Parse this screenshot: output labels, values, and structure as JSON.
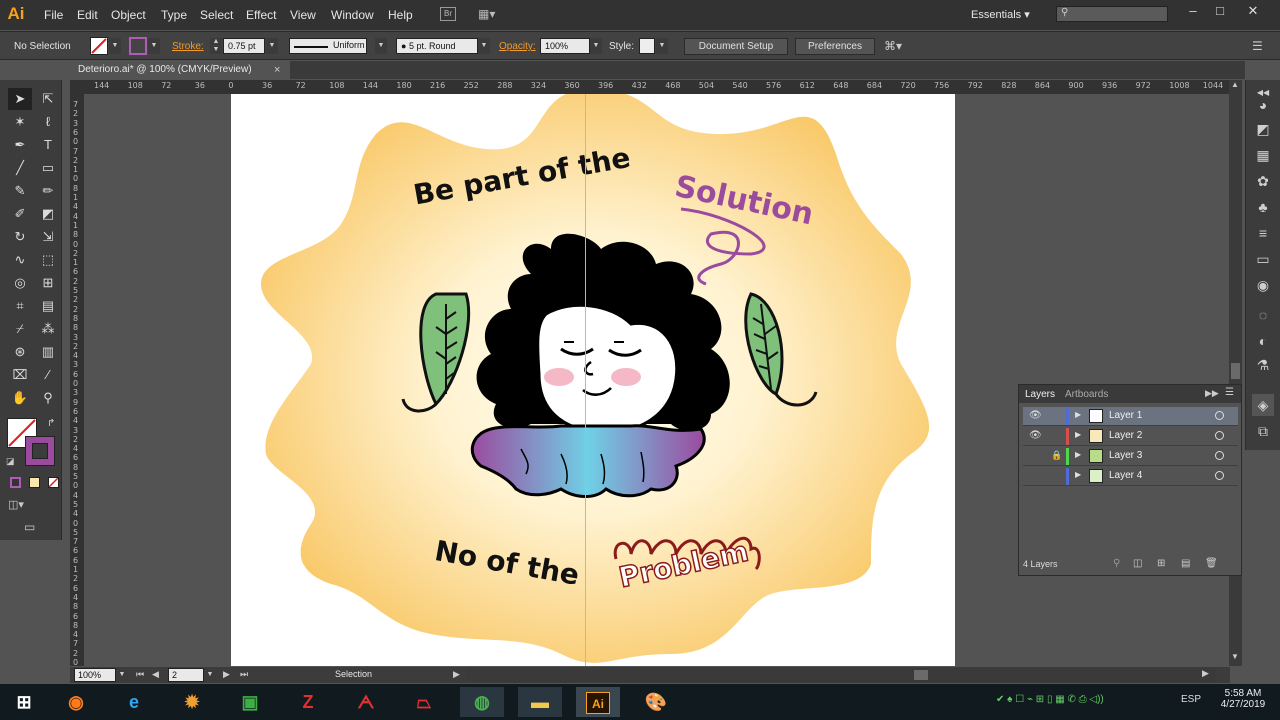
{
  "app": {
    "logo": "Ai",
    "menus": [
      "File",
      "Edit",
      "Object",
      "Type",
      "Select",
      "Effect",
      "View",
      "Window",
      "Help"
    ],
    "workspace": "Essentials",
    "window_buttons": [
      "–",
      "□",
      "✕"
    ]
  },
  "control": {
    "selection": "No Selection",
    "stroke_label": "Stroke:",
    "stroke_weight": "0.75 pt",
    "profile": "Uniform",
    "brush": "5 pt. Round",
    "opacity_label": "Opacity:",
    "opacity": "100%",
    "style_label": "Style:",
    "document_setup": "Document Setup",
    "preferences": "Preferences"
  },
  "document": {
    "tab_title": "Deterioro.ai* @ 100% (CMYK/Preview)",
    "close": "×"
  },
  "ruler": {
    "top": [
      "144",
      "108",
      "72",
      "36",
      "0",
      "36",
      "72",
      "108",
      "144",
      "180",
      "216",
      "252",
      "288",
      "324",
      "360",
      "396",
      "432",
      "468",
      "504",
      "540",
      "576",
      "612",
      "648",
      "684",
      "720",
      "756",
      "792",
      "828",
      "864",
      "900",
      "936",
      "972",
      "1008",
      "1044"
    ],
    "left": [
      "7",
      "2",
      "3",
      "6",
      "0",
      "7",
      "2",
      "1",
      "0",
      "8",
      "1",
      "4",
      "4",
      "1",
      "8",
      "0",
      "2",
      "1",
      "6",
      "2",
      "5",
      "2",
      "2",
      "8",
      "8",
      "3",
      "2",
      "4",
      "3",
      "6",
      "0",
      "3",
      "9",
      "6",
      "4",
      "3",
      "2",
      "4",
      "6",
      "8",
      "5",
      "0",
      "4",
      "5",
      "4",
      "0",
      "5",
      "7",
      "6",
      "6",
      "1",
      "2",
      "6",
      "4",
      "8",
      "6",
      "8",
      "4",
      "7",
      "2",
      "0"
    ]
  },
  "artwork": {
    "line1": "Be part of the",
    "highlight1": "Solution",
    "line2": "No of the",
    "highlight2": "Problem",
    "colors": {
      "blob_outer": "#f9c96a",
      "blob_inner": "#fffdf2",
      "solution": "#9b4b9e",
      "problem": "#8b1a1a",
      "leaf": "#7fc07a",
      "skirt_purple": "#9b4b9e",
      "skirt_blue": "#6fd0e6"
    }
  },
  "status": {
    "zoom": "100%",
    "artboard_number": "2",
    "tool": "Selection"
  },
  "layers": {
    "tabs": [
      "Layers",
      "Artboards"
    ],
    "rows": [
      {
        "name": "Layer 1",
        "color": "#4f6bd6",
        "visible": true,
        "locked": false,
        "thumb": "#ffffff"
      },
      {
        "name": "Layer 2",
        "color": "#d64f4f",
        "visible": true,
        "locked": false,
        "thumb": "#f9e9b8"
      },
      {
        "name": "Layer 3",
        "color": "#4fd64f",
        "visible": false,
        "locked": true,
        "thumb": "#b5dd8a"
      },
      {
        "name": "Layer 4",
        "color": "#4f6bd6",
        "visible": false,
        "locked": false,
        "thumb": "#dcf0c8"
      }
    ],
    "count": "4 Layers"
  },
  "taskbar": {
    "time": "5:58 AM",
    "date": "4/27/2019",
    "lang": "ESP"
  }
}
